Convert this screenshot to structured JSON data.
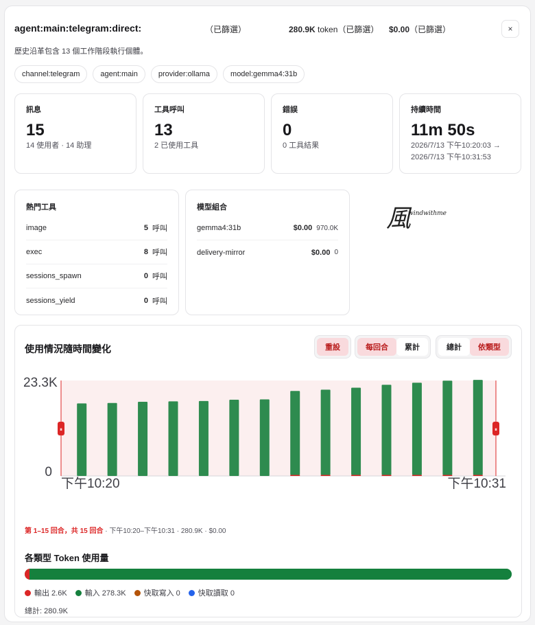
{
  "header": {
    "session_key": "agent:main:telegram:direct:",
    "filter_1": "（已篩選）",
    "tokens_value": "280.9K",
    "tokens_label": " token（已篩選）",
    "cost_value": "$0.00",
    "cost_label": "（已篩選）",
    "close_label": "×"
  },
  "summary": "歷史沿革包含 13 個工作階段執行個體。",
  "chips": [
    "channel:telegram",
    "agent:main",
    "provider:ollama",
    "model:gemma4:31b"
  ],
  "stats": [
    {
      "label": "訊息",
      "value": "15",
      "sub": "14 使用者 · 14 助理"
    },
    {
      "label": "工具呼叫",
      "value": "13",
      "sub": "2 已使用工具"
    },
    {
      "label": "錯誤",
      "value": "0",
      "sub": "0 工具結果"
    },
    {
      "label": "持續時間",
      "value": "11m 50s",
      "sub": "2026/7/13 下午10:20:03 → 2026/7/13 下午10:31:53"
    }
  ],
  "top_tools": {
    "title": "熱門工具",
    "unit": "呼叫",
    "items": [
      {
        "name": "image",
        "count": "5"
      },
      {
        "name": "exec",
        "count": "8"
      },
      {
        "name": "sessions_spawn",
        "count": "0"
      },
      {
        "name": "sessions_yield",
        "count": "0"
      }
    ]
  },
  "model_mix": {
    "title": "模型組合",
    "items": [
      {
        "name": "gemma4:31b",
        "cost": "$0.00",
        "tokens": "970.0K"
      },
      {
        "name": "delivery-mirror",
        "cost": "$0.00",
        "tokens": "0"
      }
    ]
  },
  "logo": {
    "glyph": "風",
    "text": "windwithme"
  },
  "usage_chart": {
    "title": "使用情況隨時間變化",
    "reset_label": "重設",
    "mode_per_turn": "每回合",
    "mode_cumulative": "累計",
    "view_total": "總計",
    "view_by_type": "依類型",
    "range_text": "第 1–15 回合，共 15 回合",
    "range_detail": " · 下午10:20–下午10:31 · 280.9K · $0.00",
    "grip_glyph": "⏸"
  },
  "chart_data": {
    "type": "bar",
    "y_tick_labels": [
      "23.3K",
      "0"
    ],
    "x_tick_labels": [
      "下午10:20",
      "下午10:31"
    ],
    "ylim": [
      0,
      23300
    ],
    "stacked": true,
    "series": [
      {
        "key": "input",
        "color": "#2e8b4f",
        "values": [
          17700,
          17800,
          18100,
          18200,
          18300,
          18600,
          18700,
          20500,
          20800,
          21300,
          22000,
          22500,
          23000,
          23200
        ]
      },
      {
        "key": "output",
        "color": "#dc2626",
        "values": [
          0,
          0,
          0,
          0,
          0,
          0,
          0,
          250,
          250,
          250,
          250,
          250,
          250,
          250
        ]
      }
    ],
    "selection_fill": "#fcefef",
    "selection_border": "#dc2626"
  },
  "token_types": {
    "title": "各類型 Token 使用量",
    "items": [
      {
        "label": "輸出 2.6K",
        "value": 2600,
        "color": "#dc2626"
      },
      {
        "label": "輸入 278.3K",
        "value": 278300,
        "color": "#15803d"
      },
      {
        "label": "快取寫入 0",
        "value": 0,
        "color": "#b45309"
      },
      {
        "label": "快取讀取 0",
        "value": 0,
        "color": "#2563eb"
      }
    ],
    "total": "總計: 280.9K"
  }
}
